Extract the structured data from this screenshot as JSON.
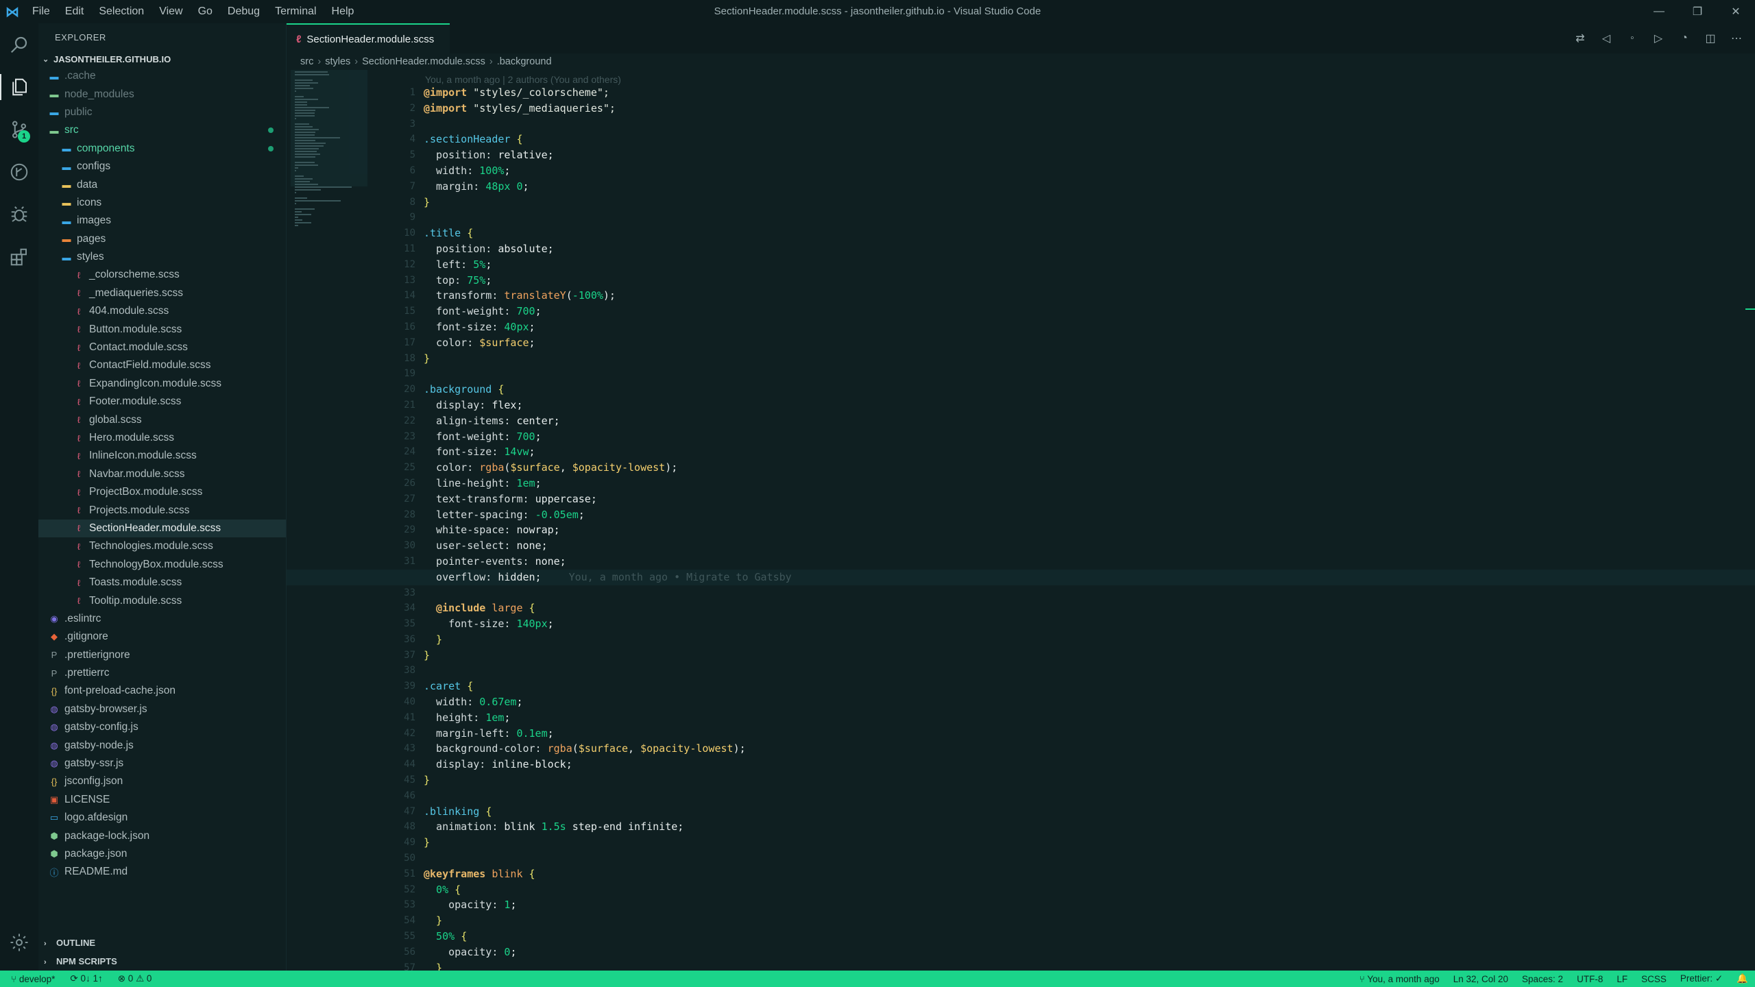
{
  "window": {
    "title": "SectionHeader.module.scss - jasontheiler.github.io - Visual Studio Code",
    "menu": [
      "File",
      "Edit",
      "Selection",
      "View",
      "Go",
      "Debug",
      "Terminal",
      "Help"
    ]
  },
  "activity": {
    "source_control_badge": "1"
  },
  "sidebar": {
    "title": "EXPLORER",
    "root": "JASONTHEILER.GITHUB.IO",
    "items": [
      {
        "label": ".cache",
        "kind": "folder",
        "level": 0
      },
      {
        "label": "node_modules",
        "kind": "folder",
        "level": 0
      },
      {
        "label": "public",
        "kind": "folder",
        "level": 0
      },
      {
        "label": "src",
        "kind": "folder-open",
        "level": 0
      },
      {
        "label": "components",
        "kind": "folder",
        "level": 1
      },
      {
        "label": "configs",
        "kind": "folder",
        "level": 1
      },
      {
        "label": "data",
        "kind": "folder",
        "level": 1
      },
      {
        "label": "icons",
        "kind": "folder",
        "level": 1
      },
      {
        "label": "images",
        "kind": "folder",
        "level": 1
      },
      {
        "label": "pages",
        "kind": "folder",
        "level": 1
      },
      {
        "label": "styles",
        "kind": "folder-open",
        "level": 1
      },
      {
        "label": "_colorscheme.scss",
        "kind": "scss",
        "level": 2
      },
      {
        "label": "_mediaqueries.scss",
        "kind": "scss",
        "level": 2
      },
      {
        "label": "404.module.scss",
        "kind": "scss",
        "level": 2
      },
      {
        "label": "Button.module.scss",
        "kind": "scss",
        "level": 2
      },
      {
        "label": "Contact.module.scss",
        "kind": "scss",
        "level": 2
      },
      {
        "label": "ContactField.module.scss",
        "kind": "scss",
        "level": 2
      },
      {
        "label": "ExpandingIcon.module.scss",
        "kind": "scss",
        "level": 2
      },
      {
        "label": "Footer.module.scss",
        "kind": "scss",
        "level": 2
      },
      {
        "label": "global.scss",
        "kind": "scss",
        "level": 2
      },
      {
        "label": "Hero.module.scss",
        "kind": "scss",
        "level": 2
      },
      {
        "label": "InlineIcon.module.scss",
        "kind": "scss",
        "level": 2
      },
      {
        "label": "Navbar.module.scss",
        "kind": "scss",
        "level": 2
      },
      {
        "label": "ProjectBox.module.scss",
        "kind": "scss",
        "level": 2
      },
      {
        "label": "Projects.module.scss",
        "kind": "scss",
        "level": 2
      },
      {
        "label": "SectionHeader.module.scss",
        "kind": "scss",
        "level": 2
      },
      {
        "label": "Technologies.module.scss",
        "kind": "scss",
        "level": 2
      },
      {
        "label": "TechnologyBox.module.scss",
        "kind": "scss",
        "level": 2
      },
      {
        "label": "Toasts.module.scss",
        "kind": "scss",
        "level": 2
      },
      {
        "label": "Tooltip.module.scss",
        "kind": "scss",
        "level": 2
      },
      {
        "label": ".eslintrc",
        "kind": "eslint",
        "level": 0
      },
      {
        "label": ".gitignore",
        "kind": "git",
        "level": 0
      },
      {
        "label": ".prettierignore",
        "kind": "prettier",
        "level": 0
      },
      {
        "label": ".prettierrc",
        "kind": "prettier",
        "level": 0
      },
      {
        "label": "font-preload-cache.json",
        "kind": "json",
        "level": 0
      },
      {
        "label": "gatsby-browser.js",
        "kind": "gatsby",
        "level": 0
      },
      {
        "label": "gatsby-config.js",
        "kind": "gatsby",
        "level": 0
      },
      {
        "label": "gatsby-node.js",
        "kind": "gatsby",
        "level": 0
      },
      {
        "label": "gatsby-ssr.js",
        "kind": "gatsby",
        "level": 0
      },
      {
        "label": "jsconfig.json",
        "kind": "json",
        "level": 0
      },
      {
        "label": "LICENSE",
        "kind": "license",
        "level": 0
      },
      {
        "label": "logo.afdesign",
        "kind": "file",
        "level": 0
      },
      {
        "label": "package-lock.json",
        "kind": "npm",
        "level": 0
      },
      {
        "label": "package.json",
        "kind": "npm",
        "level": 0
      },
      {
        "label": "README.md",
        "kind": "info",
        "level": 0
      }
    ],
    "outline": "OUTLINE",
    "npm_scripts": "NPM SCRIPTS"
  },
  "tab": {
    "label": "SectionHeader.module.scss"
  },
  "breadcrumb": [
    "src",
    "styles",
    "SectionHeader.module.scss",
    ".background"
  ],
  "editor": {
    "blame_header": "You, a month ago | 2 authors (You and others)",
    "inline_blame": "You, a month ago • Migrate to Gatsby",
    "current_line": 32,
    "lines": [
      [
        [
          "k-at",
          "@import"
        ],
        [
          "k-str",
          " \"styles/_colorscheme\";"
        ]
      ],
      [
        [
          "k-at",
          "@import"
        ],
        [
          "k-str",
          " \"styles/_mediaqueries\";"
        ]
      ],
      [],
      [
        [
          "k-sel",
          ".sectionHeader"
        ],
        [
          "k-val",
          " "
        ],
        [
          "k-brace",
          "{"
        ]
      ],
      [
        [
          "k-prop",
          "  position: "
        ],
        [
          "k-val",
          "relative;"
        ]
      ],
      [
        [
          "k-prop",
          "  width: "
        ],
        [
          "k-num",
          "100%"
        ],
        [
          "k-val",
          ";"
        ]
      ],
      [
        [
          "k-prop",
          "  margin: "
        ],
        [
          "k-num",
          "48px 0"
        ],
        [
          "k-val",
          ";"
        ]
      ],
      [
        [
          "k-brace",
          "}"
        ]
      ],
      [],
      [
        [
          "k-sel",
          ".title"
        ],
        [
          "k-val",
          " "
        ],
        [
          "k-brace",
          "{"
        ]
      ],
      [
        [
          "k-prop",
          "  position: "
        ],
        [
          "k-val",
          "absolute;"
        ]
      ],
      [
        [
          "k-prop",
          "  left: "
        ],
        [
          "k-num",
          "5%"
        ],
        [
          "k-val",
          ";"
        ]
      ],
      [
        [
          "k-prop",
          "  top: "
        ],
        [
          "k-num",
          "75%"
        ],
        [
          "k-val",
          ";"
        ]
      ],
      [
        [
          "k-prop",
          "  transform: "
        ],
        [
          "k-fn",
          "translateY"
        ],
        [
          "k-val",
          "("
        ],
        [
          "k-num",
          "-100%"
        ],
        [
          "k-val",
          ");"
        ]
      ],
      [
        [
          "k-prop",
          "  font-weight: "
        ],
        [
          "k-num",
          "700"
        ],
        [
          "k-val",
          ";"
        ]
      ],
      [
        [
          "k-prop",
          "  font-size: "
        ],
        [
          "k-num",
          "40px"
        ],
        [
          "k-val",
          ";"
        ]
      ],
      [
        [
          "k-prop",
          "  color: "
        ],
        [
          "k-var",
          "$surface"
        ],
        [
          "k-val",
          ";"
        ]
      ],
      [
        [
          "k-brace",
          "}"
        ]
      ],
      [],
      [
        [
          "k-sel",
          ".background"
        ],
        [
          "k-val",
          " "
        ],
        [
          "k-brace",
          "{"
        ]
      ],
      [
        [
          "k-prop",
          "  display: "
        ],
        [
          "k-val",
          "flex;"
        ]
      ],
      [
        [
          "k-prop",
          "  align-items: "
        ],
        [
          "k-val",
          "center;"
        ]
      ],
      [
        [
          "k-prop",
          "  font-weight: "
        ],
        [
          "k-num",
          "700"
        ],
        [
          "k-val",
          ";"
        ]
      ],
      [
        [
          "k-prop",
          "  font-size: "
        ],
        [
          "k-num",
          "14vw"
        ],
        [
          "k-val",
          ";"
        ]
      ],
      [
        [
          "k-prop",
          "  color: "
        ],
        [
          "k-fn",
          "rgba"
        ],
        [
          "k-val",
          "("
        ],
        [
          "k-var",
          "$surface"
        ],
        [
          "k-val",
          ", "
        ],
        [
          "k-var",
          "$opacity-lowest"
        ],
        [
          "k-val",
          ");"
        ]
      ],
      [
        [
          "k-prop",
          "  line-height: "
        ],
        [
          "k-num",
          "1em"
        ],
        [
          "k-val",
          ";"
        ]
      ],
      [
        [
          "k-prop",
          "  text-transform: "
        ],
        [
          "k-val",
          "uppercase;"
        ]
      ],
      [
        [
          "k-prop",
          "  letter-spacing: "
        ],
        [
          "k-num",
          "-0.05em"
        ],
        [
          "k-val",
          ";"
        ]
      ],
      [
        [
          "k-prop",
          "  white-space: "
        ],
        [
          "k-val",
          "nowrap;"
        ]
      ],
      [
        [
          "k-prop",
          "  user-select: "
        ],
        [
          "k-val",
          "none;"
        ]
      ],
      [
        [
          "k-prop",
          "  pointer-events: "
        ],
        [
          "k-val",
          "none;"
        ]
      ],
      [
        [
          "k-prop",
          "  overflow: "
        ],
        [
          "k-val",
          "hidden;"
        ]
      ],
      [],
      [
        [
          "k-at",
          "  @include"
        ],
        [
          "k-fn",
          " large"
        ],
        [
          "k-val",
          " "
        ],
        [
          "k-brace",
          "{"
        ]
      ],
      [
        [
          "k-prop",
          "    font-size: "
        ],
        [
          "k-num",
          "140px"
        ],
        [
          "k-val",
          ";"
        ]
      ],
      [
        [
          "k-brace",
          "  }"
        ]
      ],
      [
        [
          "k-brace",
          "}"
        ]
      ],
      [],
      [
        [
          "k-sel",
          ".caret"
        ],
        [
          "k-val",
          " "
        ],
        [
          "k-brace",
          "{"
        ]
      ],
      [
        [
          "k-prop",
          "  width: "
        ],
        [
          "k-num",
          "0.67em"
        ],
        [
          "k-val",
          ";"
        ]
      ],
      [
        [
          "k-prop",
          "  height: "
        ],
        [
          "k-num",
          "1em"
        ],
        [
          "k-val",
          ";"
        ]
      ],
      [
        [
          "k-prop",
          "  margin-left: "
        ],
        [
          "k-num",
          "0.1em"
        ],
        [
          "k-val",
          ";"
        ]
      ],
      [
        [
          "k-prop",
          "  background-color: "
        ],
        [
          "k-fn",
          "rgba"
        ],
        [
          "k-val",
          "("
        ],
        [
          "k-var",
          "$surface"
        ],
        [
          "k-val",
          ", "
        ],
        [
          "k-var",
          "$opacity-lowest"
        ],
        [
          "k-val",
          ");"
        ]
      ],
      [
        [
          "k-prop",
          "  display: "
        ],
        [
          "k-val",
          "inline-block;"
        ]
      ],
      [
        [
          "k-brace",
          "}"
        ]
      ],
      [],
      [
        [
          "k-sel",
          ".blinking"
        ],
        [
          "k-val",
          " "
        ],
        [
          "k-brace",
          "{"
        ]
      ],
      [
        [
          "k-prop",
          "  animation: "
        ],
        [
          "k-val",
          "blink "
        ],
        [
          "k-num",
          "1.5s"
        ],
        [
          "k-val",
          " step-end infinite;"
        ]
      ],
      [
        [
          "k-brace",
          "}"
        ]
      ],
      [],
      [
        [
          "k-at",
          "@keyframes"
        ],
        [
          "k-fn",
          " blink"
        ],
        [
          "k-val",
          " "
        ],
        [
          "k-brace",
          "{"
        ]
      ],
      [
        [
          "k-num",
          "  0%"
        ],
        [
          "k-val",
          " "
        ],
        [
          "k-brace",
          "{"
        ]
      ],
      [
        [
          "k-prop",
          "    opacity: "
        ],
        [
          "k-num",
          "1"
        ],
        [
          "k-val",
          ";"
        ]
      ],
      [
        [
          "k-brace",
          "  }"
        ]
      ],
      [
        [
          "k-num",
          "  50%"
        ],
        [
          "k-val",
          " "
        ],
        [
          "k-brace",
          "{"
        ]
      ],
      [
        [
          "k-prop",
          "    opacity: "
        ],
        [
          "k-num",
          "0"
        ],
        [
          "k-val",
          ";"
        ]
      ],
      [
        [
          "k-brace",
          "  }"
        ]
      ]
    ]
  },
  "status": {
    "branch": "develop*",
    "sync": "0↓ 1↑",
    "problems": "⊗ 0  ⚠ 0",
    "blame": "You, a month ago",
    "position": "Ln 32, Col 20",
    "spaces": "Spaces: 2",
    "encoding": "UTF-8",
    "eol": "LF",
    "language": "SCSS",
    "formatter": "Prettier: ✓"
  },
  "colors": {
    "accent": "#1bd48a",
    "background": "#0f1f21",
    "scss_icon": "#e05b7a"
  }
}
